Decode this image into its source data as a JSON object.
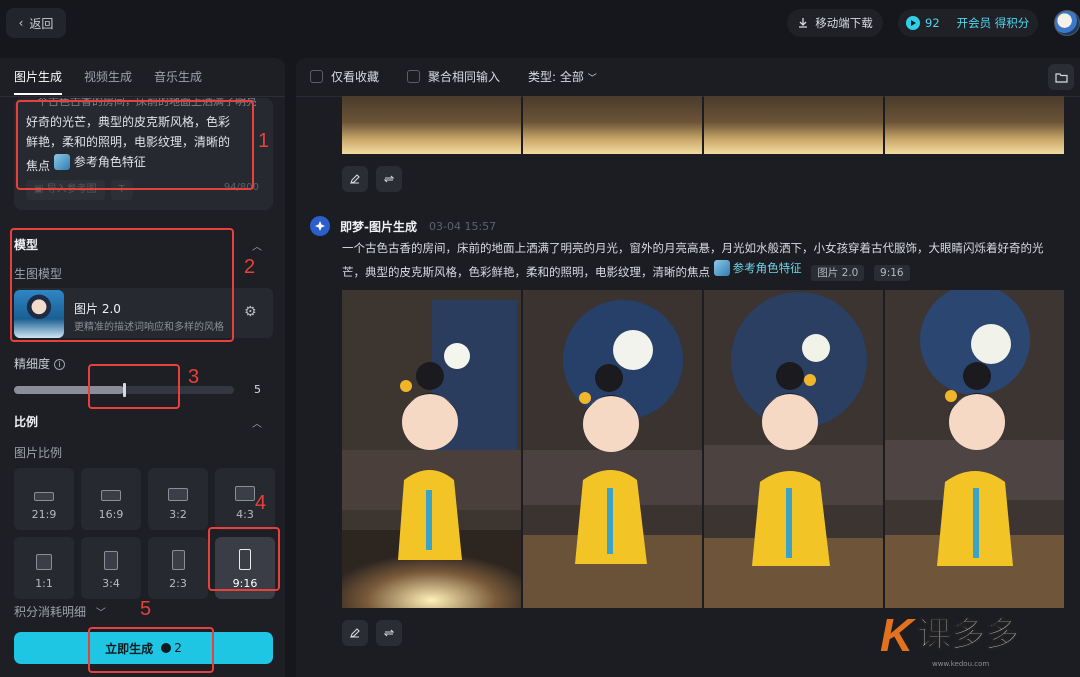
{
  "topbar": {
    "back_label": "返回",
    "mobile_download_label": "移动端下载",
    "credits": "92",
    "vip_label": "开会员 得积分"
  },
  "left": {
    "tabs": [
      "图片生成",
      "视频生成",
      "音乐生成"
    ],
    "prompt": {
      "cut_line": "一个古色古香的房间，床前的地面上洒满了明亮的月光",
      "text": "好奇的光芒，典型的皮克斯风格，色彩鲜艳，柔和的照明，电影纹理，清晰的焦点",
      "char_ref_label": "参考角色特征",
      "tool_upload": "导入参考图",
      "tool_t": "T",
      "char_count": "94/800"
    },
    "model_section": {
      "title": "模型",
      "sub_label": "生图模型",
      "model_name": "图片 2.0",
      "model_desc": "更精准的描述词响应和多样的风格"
    },
    "detail": {
      "label": "精细度",
      "value": "5",
      "fraction": 0.5
    },
    "ratio_section": {
      "title": "比例",
      "sub_label": "图片比例",
      "ratios": [
        "21:9",
        "16:9",
        "3:2",
        "4:3",
        "1:1",
        "3:4",
        "2:3",
        "9:16"
      ],
      "selected": "9:16"
    },
    "cost_label": "积分消耗明细",
    "generate_label": "立即生成",
    "generate_cost": "2"
  },
  "main": {
    "filters": {
      "favorites": "仅看收藏",
      "merge": "聚合相同输入",
      "type_label": "类型: 全部"
    },
    "record": {
      "title": "即梦-图片生成",
      "time": "03-04  15:57",
      "desc": "一个古色古香的房间，床前的地面上洒满了明亮的月光，窗外的月亮高悬，月光如水般洒下，小女孩穿着古代服饰，大眼睛闪烁着好奇的光芒，典型的皮克斯风格，色彩鲜艳，柔和的照明，电影纹理，清晰的焦点",
      "char_tag": "参考角色特征",
      "model_tag": "图片 2.0",
      "ratio_tag": "9:16"
    }
  },
  "annotations": [
    "1",
    "2",
    "3",
    "4",
    "5"
  ],
  "watermark": {
    "k": "K",
    "text": "课多多",
    "url": "www.kedou.com"
  },
  "colors": {
    "accent": "#1ec6e3",
    "annotation": "#e8403a",
    "background": "#16171c"
  }
}
